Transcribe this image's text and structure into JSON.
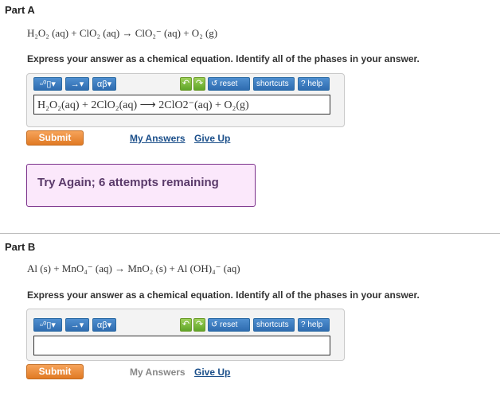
{
  "partA": {
    "label": "Part A",
    "given_equation": "H₂O₂ (aq) + ClO₂ (aq)  →  ClO₂⁻ (aq)  +  O₂ (g)",
    "instruction": "Express your answer as a chemical equation. Identify all of the phases in your answer.",
    "toolbar": {
      "template_icon": "template-icon",
      "arrow_menu": "→▾",
      "greek_menu": "αβ▾",
      "undo_icon": "undo-icon",
      "redo_icon": "redo-icon",
      "reset": "reset",
      "shortcuts": "shortcuts",
      "help": "? help"
    },
    "answer_value": "H₂O₂(aq) + 2ClO₂(aq) ⟶ 2ClO2⁻(aq) + O₂(g)",
    "submit_label": "Submit",
    "my_answers": "My Answers",
    "give_up": "Give Up",
    "feedback": "Try Again; 6 attempts remaining"
  },
  "partB": {
    "label": "Part B",
    "given_equation": "Al (s) + MnO₄⁻ (aq)  →  MnO₂ (s)  +  Al (OH)₄⁻ (aq)",
    "instruction": "Express your answer as a chemical equation. Identify all of the phases in your answer.",
    "toolbar": {
      "template_icon": "template-icon",
      "arrow_menu": "→▾",
      "greek_menu": "αβ▾",
      "undo_icon": "undo-icon",
      "redo_icon": "redo-icon",
      "reset": "reset",
      "shortcuts": "shortcuts",
      "help": "? help"
    },
    "answer_value": "",
    "submit_label": "Submit",
    "my_answers": "My Answers",
    "give_up": "Give Up"
  },
  "colors": {
    "toolbar_blue": "#2f6cb0",
    "submit_orange": "#e17a24",
    "feedback_border": "#7a2f8a",
    "feedback_bg": "#fbe8fb"
  }
}
